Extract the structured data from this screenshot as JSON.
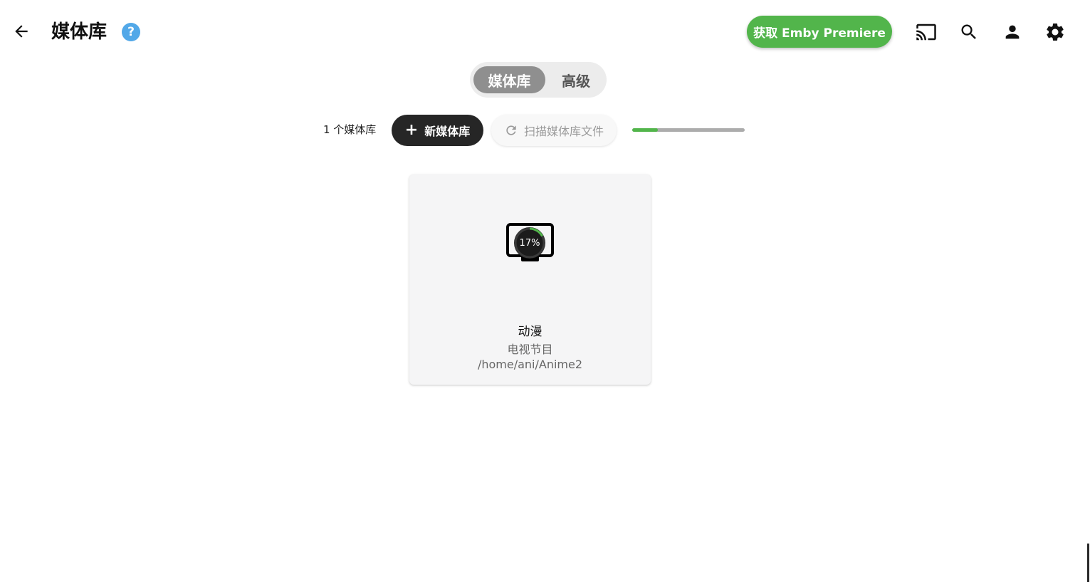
{
  "header": {
    "title": "媒体库",
    "help_icon": "?",
    "premiere_button": "获取 Emby Premiere",
    "icons": [
      "back-arrow-icon",
      "help-icon",
      "cast-icon",
      "search-icon",
      "user-icon",
      "gear-icon"
    ]
  },
  "tabs": [
    {
      "label": "媒体库",
      "active": true
    },
    {
      "label": "高级",
      "active": false
    }
  ],
  "toolbar": {
    "library_count": "1 个媒体库",
    "new_library_label": "新媒体库",
    "new_library_icon": "+",
    "scan_label": "扫描媒体库文件",
    "scan_icon": "refresh-icon",
    "scan_progress": 0.23
  },
  "libraries": [
    {
      "name": "动漫",
      "type": "电视节目",
      "path": "/home/ani/Anime2",
      "icon": "tv-icon",
      "progress_text": "17%",
      "progress": 0.17
    }
  ],
  "colors": {
    "accent_green": "#52b54b",
    "help_blue": "#52a8e8",
    "dark_button": "#262626",
    "active_tab": "#8f8f8f"
  }
}
